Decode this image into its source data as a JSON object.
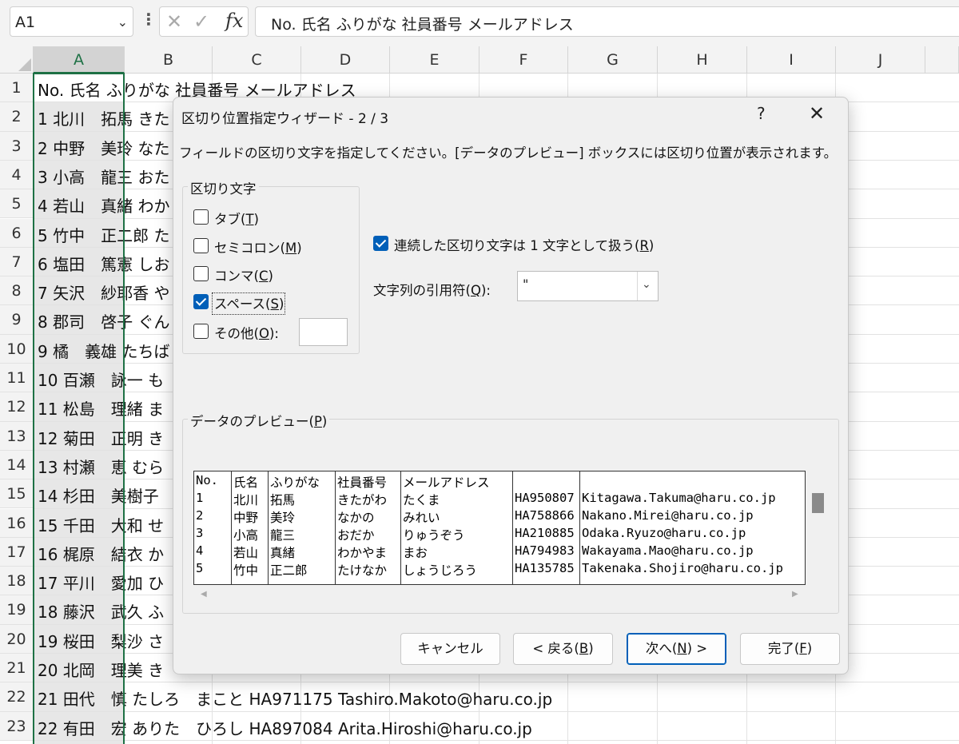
{
  "formula_bar": {
    "name_box": "A1",
    "chevron_glyph": "⌄",
    "dots_glyph": "⋮",
    "cancel_glyph": "✕",
    "enter_glyph": "✓",
    "fx_label": "fx",
    "content": "No. 氏名 ふりがな 社員番号 メールアドレス"
  },
  "columns": [
    "A",
    "B",
    "C",
    "D",
    "E",
    "F",
    "G",
    "H",
    "I",
    "J"
  ],
  "rows": [
    "1",
    "2",
    "3",
    "4",
    "5",
    "6",
    "7",
    "8",
    "9",
    "10",
    "11",
    "12",
    "13",
    "14",
    "15",
    "16",
    "17",
    "18",
    "19",
    "20",
    "21",
    "22",
    "23"
  ],
  "cells": [
    "No. 氏名 ふりがな 社員番号 メールアドレス",
    "1 北川　拓馬 きた",
    "2 中野　美玲 なた",
    "3 小高　龍三 おた",
    "4 若山　真緒 わか",
    "5 竹中　正二郎 た",
    "6 塩田　篤憲 しお",
    "7 矢沢　紗耶香 や",
    "8 郡司　啓子 ぐん",
    "9 橘　義雄 たちば",
    "10 百瀬　詠一 も",
    "11 松島　理緒 ま",
    "12 菊田　正明 き",
    "13 村瀬　恵 むら",
    "14 杉田　美樹子",
    "15 千田　大和 せ",
    "16 梶原　結衣 か",
    "17 平川　愛加 ひ",
    "18 藤沢　武久 ふ",
    "19 桜田　梨沙 さ",
    "20 北岡　理美 き",
    "21 田代　慎 たしろ　まこと HA971175 Tashiro.Makoto@haru.co.jp",
    "22 有田　宏 ありた　ひろし HA897084 Arita.Hiroshi@haru.co.jp"
  ],
  "dialog": {
    "title": "区切り位置指定ウィザード - 2 / 3",
    "help": "?",
    "close_glyph": "✕",
    "instruction": "フィールドの区切り文字を指定してください。[データのプレビュー] ボックスには区切り位置が表示されます。",
    "delimiters_group": "区切り文字",
    "delimiters": [
      {
        "label": "タブ",
        "key": "T",
        "checked": false
      },
      {
        "label": "セミコロン",
        "key": "M",
        "checked": false
      },
      {
        "label": "コンマ",
        "key": "C",
        "checked": false
      },
      {
        "label": "スペース",
        "key": "S",
        "checked": true
      },
      {
        "label": "その他",
        "key": "O",
        "checked": false,
        "suffix": ":"
      }
    ],
    "consecutive": {
      "label": "連続した区切り文字は 1 文字として扱う",
      "key": "R",
      "checked": true
    },
    "text_qualifier": {
      "label": "文字列の引用符",
      "key": "Q",
      "value": "\"",
      "arrow_glyph": "⌄"
    },
    "preview_label": "データのプレビュー",
    "preview_key": "P",
    "preview": {
      "columns": [
        [
          "No.",
          "1",
          "2",
          "3",
          "4",
          "5"
        ],
        [
          "氏名",
          "北川",
          "中野",
          "小高",
          "若山",
          "竹中"
        ],
        [
          "ふりがな",
          "拓馬",
          "美玲",
          "龍三",
          "真緒",
          "正二郎"
        ],
        [
          "社員番号",
          "きたがわ",
          "なかの",
          "おだか",
          "わかやま",
          "たけなか"
        ],
        [
          "メールアドレス",
          "たくま",
          "みれい",
          "りゅうぞう",
          "まお",
          "しょうじろう"
        ],
        [
          "",
          "HA950807",
          "HA758866",
          "HA210885",
          "HA794983",
          "HA135785"
        ],
        [
          "",
          "Kitagawa.Takuma@haru.co.jp",
          "Nakano.Mirei@haru.co.jp",
          "Odaka.Ryuzo@haru.co.jp",
          "Wakayama.Mao@haru.co.jp",
          "Takenaka.Shojiro@haru.co.jp"
        ]
      ]
    },
    "scroll_left_glyph": "◀",
    "scroll_right_glyph": "▶",
    "buttons": {
      "cancel": "キャンセル",
      "back_prefix": "< 戻る(",
      "back_key": "B",
      "back_suffix": ")",
      "next_prefix": "次へ(",
      "next_key": "N",
      "next_suffix": ") >",
      "finish_prefix": "完了(",
      "finish_key": "F",
      "finish_suffix": ")"
    }
  },
  "colors": {
    "selection_green": "#1e7145",
    "accent_blue": "#005fb8",
    "dialog_bg": "#f0f0f0"
  }
}
